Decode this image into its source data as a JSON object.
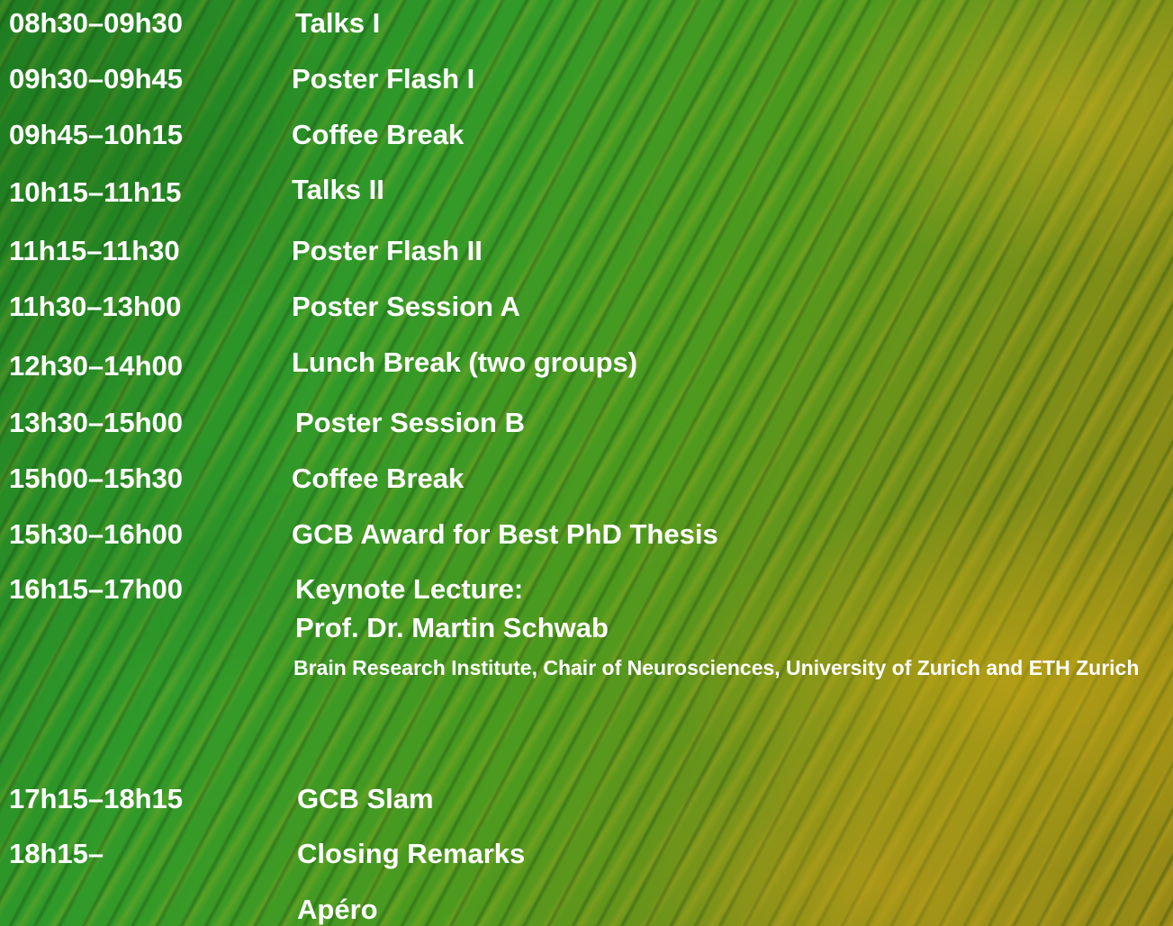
{
  "schedule": [
    {
      "time": "08h30–09h30",
      "title": "Talks I"
    },
    {
      "time": "09h30–09h45",
      "title": "Poster Flash I"
    },
    {
      "time": "09h45–10h15",
      "title": "Coffee Break"
    },
    {
      "time": "10h15–11h15",
      "title": "Talks II"
    },
    {
      "time": "11h15–11h30",
      "title": "Poster Flash II"
    },
    {
      "time": "11h30–13h00",
      "title": "Poster Session A"
    },
    {
      "time": "12h30–14h00",
      "title": "Lunch Break (two groups)"
    },
    {
      "time": "13h30–15h00",
      "title": "Poster Session B"
    },
    {
      "time": "15h00–15h30",
      "title": "Coffee Break"
    },
    {
      "time": "15h30–16h00",
      "title": "GCB Award for Best PhD Thesis"
    },
    {
      "time": "16h15–17h00",
      "title": "Keynote Lecture:",
      "speaker": "Prof. Dr. Martin Schwab",
      "affiliation": "Brain Research Institute, Chair of Neurosciences, University of Zurich and ETH Zurich"
    },
    {
      "time": "17h15–18h15",
      "title": "GCB Slam"
    },
    {
      "time": "18h15–",
      "title": "Closing Remarks"
    },
    {
      "time": "",
      "title": "Apéro"
    }
  ]
}
